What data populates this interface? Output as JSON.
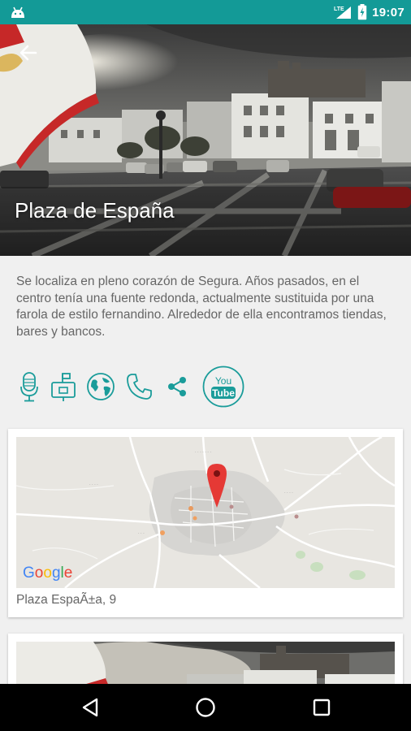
{
  "status_bar": {
    "time": "19:07",
    "network": "LTE",
    "icons": [
      "android-icon",
      "lte-signal-icon",
      "battery-charging-icon"
    ]
  },
  "header": {
    "title": "Plaza de España",
    "back_icon": "arrow-back-icon"
  },
  "description": "Se localiza en pleno corazón de Segura. Años pasados, en el centro tenía una fuente redonda, actualmente sustituida por una farola de estilo fernandino. Alrededor de ella encontramos tiendas, bares y bancos.",
  "actions": [
    {
      "name": "microphone-icon"
    },
    {
      "name": "mailbox-icon"
    },
    {
      "name": "globe-icon"
    },
    {
      "name": "phone-icon"
    },
    {
      "name": "share-icon"
    },
    {
      "name": "youtube-icon",
      "label_top": "You",
      "label_bottom": "Tube"
    }
  ],
  "map": {
    "provider_logo": "Google",
    "address": "Plaza EspaÃ±a, 9"
  },
  "colors": {
    "accent": "#139a97",
    "icon_teal": "#1a9c9a",
    "text_gray": "#666666",
    "pin_red": "#e53935"
  },
  "nav_bar": {
    "icons": [
      "back-triangle-icon",
      "home-circle-icon",
      "recents-square-icon"
    ]
  }
}
